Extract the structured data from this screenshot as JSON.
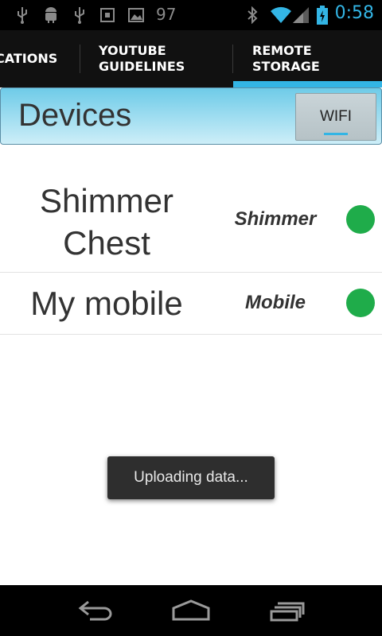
{
  "status_bar": {
    "battery_level": "97",
    "time": "0:58",
    "icons": [
      "usb-icon",
      "android-debug-icon",
      "usb-icon",
      "sd-card-icon",
      "picture-icon",
      "bluetooth-icon",
      "wifi-icon",
      "signal-icon",
      "battery-charging-icon"
    ]
  },
  "tabs": [
    {
      "label": "CATIONS",
      "selected": false
    },
    {
      "label": "YOUTUBE\nGUIDELINES",
      "selected": false
    },
    {
      "label": "REMOTE\nSTORAGE",
      "selected": true
    }
  ],
  "header": {
    "title": "Devices",
    "wifi_button": "WIFI"
  },
  "devices": [
    {
      "name": "Shimmer\nChest",
      "type": "Shimmer",
      "status_color": "#1fac4a"
    },
    {
      "name": "My mobile",
      "type": "Mobile",
      "status_color": "#1fac4a"
    }
  ],
  "toast": {
    "text": "Uploading data..."
  },
  "navigation": {
    "buttons": [
      "back-icon",
      "home-icon",
      "recent-apps-icon"
    ]
  },
  "colors": {
    "accent": "#33b5e5",
    "status_online": "#1fac4a"
  }
}
